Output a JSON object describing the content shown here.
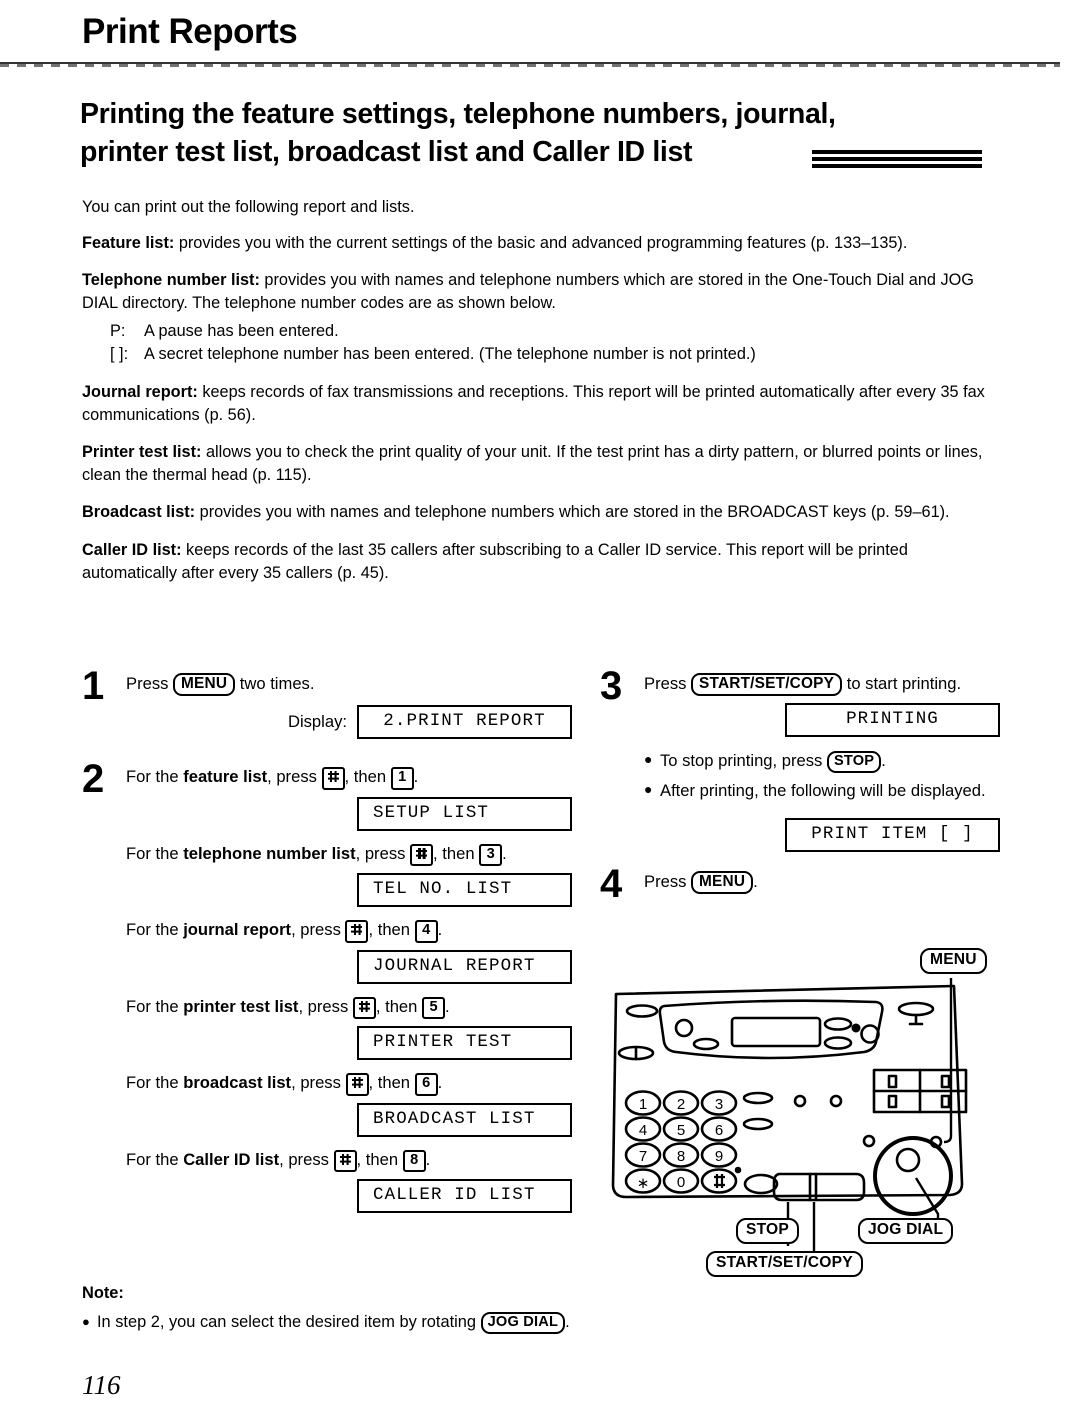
{
  "header": {
    "chapter_title": "Print Reports"
  },
  "section": {
    "heading_line1": "Printing the feature settings, telephone numbers, journal,",
    "heading_line2": "printer test list, broadcast list and Caller ID list"
  },
  "intro": {
    "lead": "You can print out the following report and lists.",
    "items": [
      {
        "term": "Feature list:",
        "text": " provides you with the current settings of the basic and advanced programming features (p. 133–135)."
      },
      {
        "term": "Telephone number list:",
        "text": " provides you with names and telephone numbers which are stored in the One-Touch Dial and JOG DIAL directory. The telephone number codes are as shown below."
      },
      {
        "term": "Journal report:",
        "text": " keeps records of fax transmissions and receptions. This report will be printed automatically after every 35 fax communications (p. 56)."
      },
      {
        "term": "Printer test list:",
        "text": " allows you to check the print quality of your unit. If the test print has a dirty pattern, or blurred points or lines, clean the thermal head (p. 115)."
      },
      {
        "term": "Broadcast list:",
        "text": " provides you with names and telephone numbers which are stored in the BROADCAST keys (p. 59–61)."
      },
      {
        "term": "Caller ID list:",
        "text": " keeps records of the last 35 callers after subscribing to a Caller ID service. This report will be printed automatically after every 35 callers (p. 45)."
      }
    ],
    "codes": [
      {
        "symbol": "P:",
        "desc": "A pause has been entered."
      },
      {
        "symbol": "[  ]:",
        "desc": "A secret telephone number has been entered. (The telephone number is not printed.)"
      }
    ]
  },
  "steps": {
    "step1": {
      "number": "1",
      "text_before": "Press ",
      "key": "MENU",
      "text_after": " two times.",
      "display_label": "Display:",
      "lcd": "2.PRINT REPORT"
    },
    "step2": {
      "number": "2",
      "rows": [
        {
          "prefix": "For the ",
          "bold": "feature list",
          "mid": ", press ",
          "key1": "#",
          "mid2": ", then ",
          "key2": "1",
          "suffix": ".",
          "lcd": "SETUP LIST"
        },
        {
          "prefix": "For the ",
          "bold": "telephone number list",
          "mid": ", press ",
          "key1": "#",
          "mid2": ", then ",
          "key2": "3",
          "suffix": ".",
          "lcd": "TEL NO. LIST"
        },
        {
          "prefix": "For the ",
          "bold": "journal report",
          "mid": ", press ",
          "key1": "#",
          "mid2": ", then ",
          "key2": "4",
          "suffix": ".",
          "lcd": "JOURNAL REPORT"
        },
        {
          "prefix": "For the ",
          "bold": "printer test list",
          "mid": ", press ",
          "key1": "#",
          "mid2": ", then ",
          "key2": "5",
          "suffix": ".",
          "lcd": "PRINTER TEST"
        },
        {
          "prefix": "For the ",
          "bold": "broadcast list",
          "mid": ", press ",
          "key1": "#",
          "mid2": ", then ",
          "key2": "6",
          "suffix": ".",
          "lcd": "BROADCAST LIST"
        },
        {
          "prefix": "For the ",
          "bold": "Caller ID list",
          "mid": ", press ",
          "key1": "#",
          "mid2": ", then ",
          "key2": "8",
          "suffix": ".",
          "lcd": "CALLER ID LIST"
        }
      ]
    },
    "step3": {
      "number": "3",
      "text_before": "Press ",
      "key": "START/SET/COPY",
      "text_after": " to start printing.",
      "lcd1": "PRINTING",
      "bullet1_before": "To stop printing, press ",
      "bullet1_key": "STOP",
      "bullet1_after": ".",
      "bullet2": "After printing, the following will be displayed.",
      "lcd2": "PRINT ITEM [  ]"
    },
    "step4": {
      "number": "4",
      "text_before": "Press ",
      "key": "MENU",
      "text_after": "."
    }
  },
  "device": {
    "callouts": {
      "menu": "MENU",
      "stop": "STOP",
      "start": "START/SET/COPY",
      "jog": "JOG DIAL"
    },
    "keypad": [
      [
        "1",
        "2",
        "3"
      ],
      [
        "4",
        "5",
        "6"
      ],
      [
        "7",
        "8",
        "9"
      ],
      [
        "∗",
        "0",
        "#"
      ]
    ]
  },
  "note": {
    "title": "Note:",
    "item_before": "In step 2, you can select the desired item by rotating ",
    "item_key": "JOG DIAL",
    "item_after": "."
  },
  "footer": {
    "page_number": "116"
  }
}
